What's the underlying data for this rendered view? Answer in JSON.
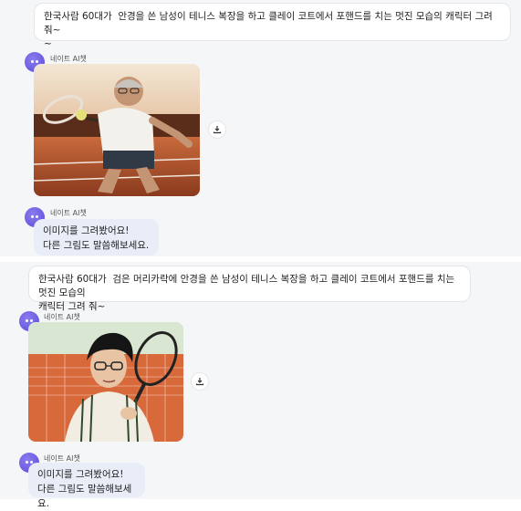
{
  "conversation_1": {
    "user_prompt": "한국사람 60대가  안경을 쓴 남성이 테니스 복장을 하고 클레이 코트에서 포핸드를 치는 멋진 모습의 캐릭터 그려 줘~\n~",
    "bot_name": "네이트 AI챗",
    "bot_name_2": "네이트 AI챗",
    "reply_line1": "이미지를 그려봤어요!",
    "reply_line2": "다른 그림도 말씀해보세요."
  },
  "conversation_2": {
    "user_prompt": "한국사람 60대가  검은 머리카락에 안경을 쓴 남성이 테니스 복장을 하고 클레이 코트에서 포핸드를 치는 멋진 모습의\n캐릭터 그려 줘~",
    "bot_name": "네이트 AI챗",
    "bot_name_2": "네이트 AI챗",
    "reply_line1": "이미지를 그려봤어요!",
    "reply_line2": "다른 그림도 말씀해보세요."
  },
  "icons": {
    "avatar": "bot-face-icon",
    "download": "download-icon"
  },
  "colors": {
    "avatar": "#6a5ae0",
    "bot_bubble": "#e8edf8",
    "panel_bg": "#f5f6f8"
  }
}
